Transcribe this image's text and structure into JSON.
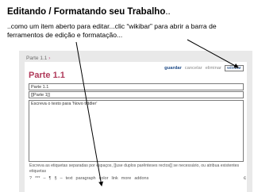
{
  "slide": {
    "title": "Editando / Formatando seu Trabalho",
    "title_suffix": "..",
    "text": "..como um item aberto para editar...clic “wikibar” para abrir a barra de ferramentos de edição e formatação..."
  },
  "wiki": {
    "breadcrumb": "Parte 1.1",
    "breadcrumb_arrow": "›",
    "toolbar": {
      "save": "guardar",
      "cancel": "cancelar",
      "delete": "eliminar",
      "wikibar": "wikibar"
    },
    "page_title": "Parte 1.1",
    "fields": {
      "title_value": "Parte 1.1",
      "tiddler_link": "[[Parte 1]]",
      "body_placeholder": "Escreva o texto para 'Novo tiddler'"
    },
    "tags_help": "Escreva as etiquetas separadas por espaços, [[use duplos parênteses rectos]] se necessário, ou atribua existentes etiquetas",
    "format_bar": [
      "?",
      "***",
      "–",
      "¶",
      "§",
      "–",
      "text",
      "paragraph",
      "color",
      "link",
      "more",
      "addons"
    ],
    "edge_letter": "c"
  },
  "colors": {
    "page_title": "#b03a5a",
    "toolbar_link": "#1d4a86",
    "frame_bg": "#e9e9e9"
  }
}
